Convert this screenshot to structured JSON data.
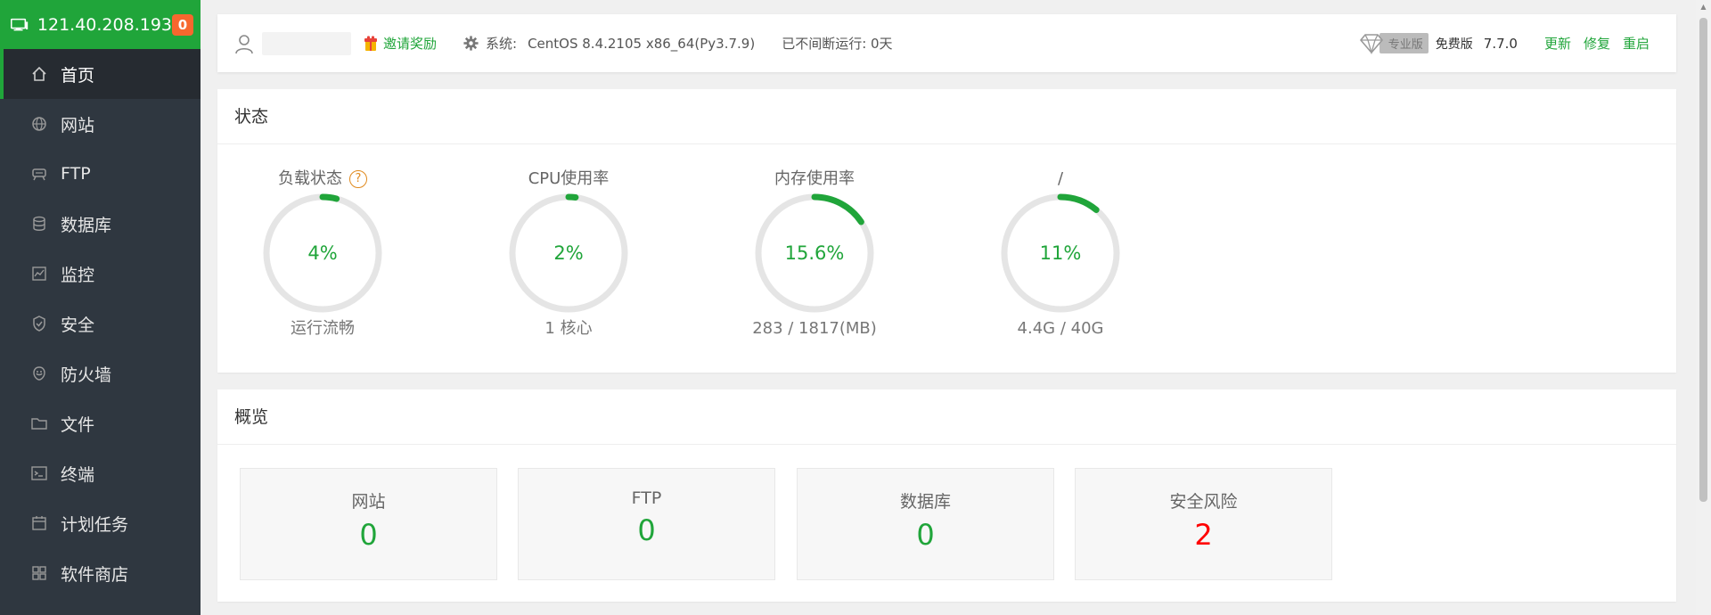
{
  "server": {
    "ip": "121.40.208.193",
    "badge": "0"
  },
  "sidebar": {
    "items": [
      {
        "label": "首页",
        "icon": "home-icon",
        "active": true
      },
      {
        "label": "网站",
        "icon": "globe-icon"
      },
      {
        "label": "FTP",
        "icon": "ftp-icon"
      },
      {
        "label": "数据库",
        "icon": "database-icon"
      },
      {
        "label": "监控",
        "icon": "monitor-icon"
      },
      {
        "label": "安全",
        "icon": "shield-icon"
      },
      {
        "label": "防火墙",
        "icon": "firewall-icon"
      },
      {
        "label": "文件",
        "icon": "folder-icon"
      },
      {
        "label": "终端",
        "icon": "terminal-icon"
      },
      {
        "label": "计划任务",
        "icon": "calendar-icon"
      },
      {
        "label": "软件商店",
        "icon": "grid-icon"
      }
    ]
  },
  "topbar": {
    "invite": "邀请奖励",
    "system_label": "系统:",
    "system_value": "CentOS 8.4.2105 x86_64(Py3.7.9)",
    "uptime": "已不间断运行: 0天",
    "pro_label": "专业版",
    "edition": "免费版",
    "version": "7.7.0",
    "update": "更新",
    "repair": "修复",
    "restart": "重启"
  },
  "status": {
    "title": "状态",
    "gauges": [
      {
        "title": "负载状态",
        "value": "4%",
        "percent": 4,
        "sub": "运行流畅",
        "help": "?"
      },
      {
        "title": "CPU使用率",
        "value": "2%",
        "percent": 2,
        "sub": "1 核心"
      },
      {
        "title": "内存使用率",
        "value": "15.6%",
        "percent": 15.6,
        "sub": "283 / 1817(MB)"
      },
      {
        "title": "/",
        "value": "11%",
        "percent": 11,
        "sub": "4.4G / 40G"
      }
    ]
  },
  "overview": {
    "title": "概览",
    "cards": [
      {
        "label": "网站",
        "value": "0"
      },
      {
        "label": "FTP",
        "value": "0"
      },
      {
        "label": "数据库",
        "value": "0"
      },
      {
        "label": "安全风险",
        "value": "2",
        "alert": true
      }
    ]
  },
  "colors": {
    "accent": "#20a53a",
    "sidebar": "#2f3740",
    "badge": "#f7672e",
    "danger": "#ff0000",
    "ring_track": "#e5e5e5"
  }
}
